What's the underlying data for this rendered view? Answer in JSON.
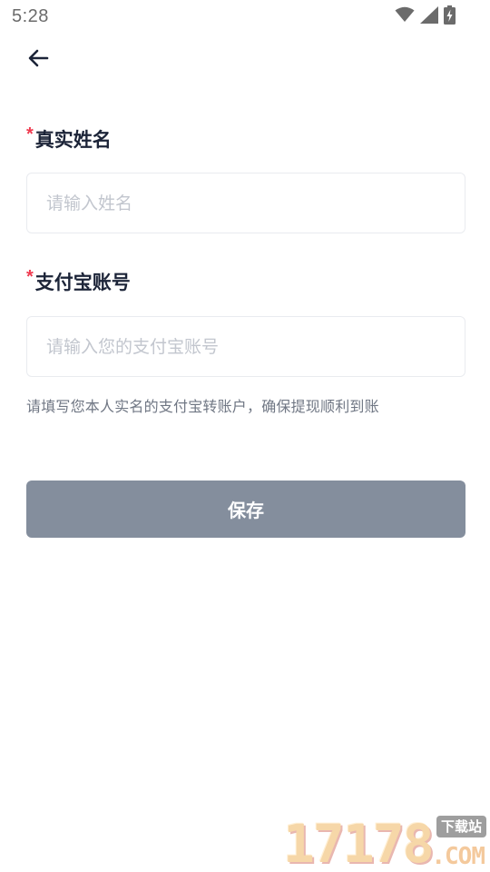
{
  "status_bar": {
    "time": "5:28",
    "icons": [
      "wifi-icon",
      "cell-signal-icon",
      "battery-charging-icon"
    ]
  },
  "nav": {
    "back_icon": "arrow-left-icon"
  },
  "form": {
    "name_label": "真实姓名",
    "name_required": "*",
    "name_placeholder": "请输入姓名",
    "name_value": "",
    "account_label": "支付宝账号",
    "account_required": "*",
    "account_placeholder": "请输入您的支付宝账号",
    "account_value": "",
    "hint": "请填写您本人实名的支付宝转账户，确保提现顺利到账"
  },
  "actions": {
    "save_label": "保存"
  },
  "watermark": {
    "number": "17178",
    "badge": "下载站",
    "domain": ".COM"
  },
  "colors": {
    "required": "#ef3b50",
    "label": "#1c2438",
    "button_bg": "#848e9d",
    "placeholder": "#c2c6ce",
    "hint": "#707784"
  }
}
